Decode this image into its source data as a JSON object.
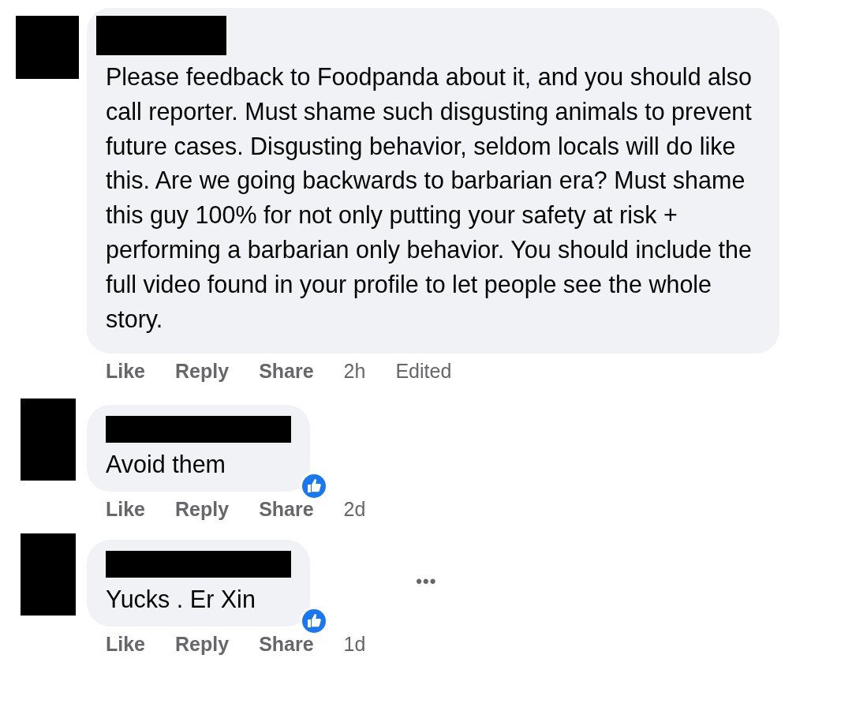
{
  "comments": [
    {
      "author": {
        "redacted": true
      },
      "text": "Please feedback to Foodpanda about it, and you should also call reporter. Must shame such disgusting animals to prevent future cases. Disgusting behavior, seldom locals will do like this. Are we going backwards to barbarian era? Must shame this guy 100% for not only putting your safety at risk + performing a barbarian only behavior. You should include the full video found in your profile to let people see the whole story.",
      "reaction": false,
      "actions": [
        "Like",
        "Reply",
        "Share"
      ],
      "time": "2h",
      "edited": "Edited"
    },
    {
      "author": {
        "redacted": true
      },
      "text": "Avoid them",
      "reaction": true,
      "actions": [
        "Like",
        "Reply",
        "Share"
      ],
      "time": "2d"
    },
    {
      "author": {
        "redacted": true
      },
      "text": "Yucks . Er Xin",
      "reaction": true,
      "more_label": "•••",
      "actions": [
        "Like",
        "Reply",
        "Share"
      ],
      "time": "1d"
    }
  ]
}
